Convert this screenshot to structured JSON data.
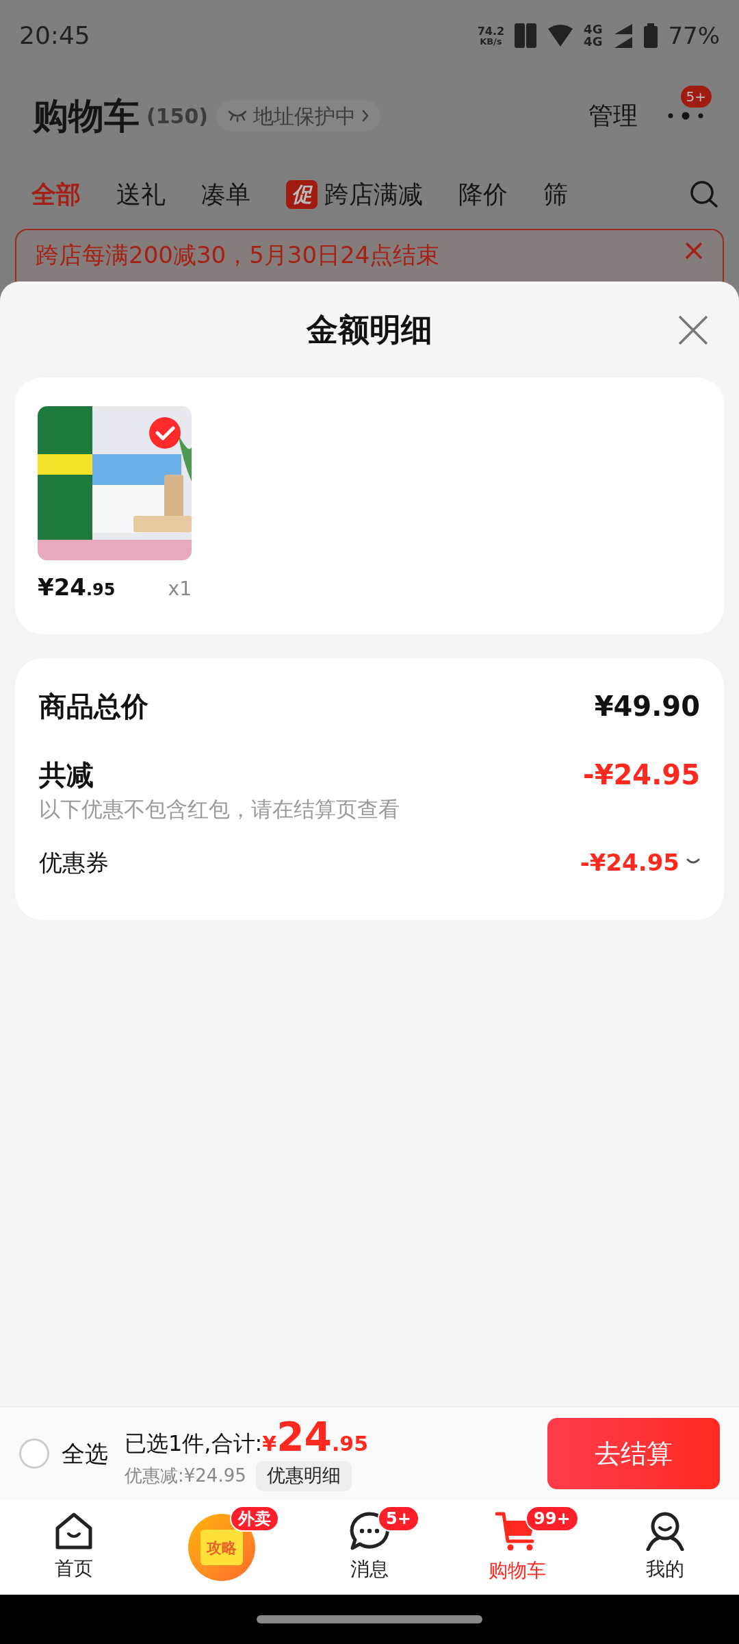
{
  "status_bar": {
    "time": "20:45",
    "net_speed": "74.2",
    "net_unit": "KB/s",
    "signal_labels": [
      "4G",
      "4G"
    ],
    "battery": "77%"
  },
  "header": {
    "title": "购物车",
    "count": "(150)",
    "address_chip": "地址保护中",
    "manage": "管理",
    "more_badge": "5+"
  },
  "filter_tabs": [
    {
      "label": "全部",
      "selected": true
    },
    {
      "label": "送礼",
      "selected": false
    },
    {
      "label": "凑单",
      "selected": false
    },
    {
      "label": "跨店满减",
      "selected": false,
      "tag": "促"
    },
    {
      "label": "降价",
      "selected": false
    },
    {
      "label": "筛",
      "selected": false
    }
  ],
  "promo_banner": {
    "text": "跨店每满200减30，5月30日24点结束"
  },
  "sheet": {
    "title": "金额明细",
    "items": [
      {
        "kind": "picture",
        "selected": true,
        "price_main": "¥24",
        "price_decimal": ".95",
        "quantity": "x1"
      }
    ],
    "summary": {
      "total_label": "商品总价",
      "total_value": "¥49.90",
      "discount_label": "共减",
      "discount_value": "-¥24.95",
      "discount_note": "以下优惠不包含红包，请在结算页查看",
      "coupon_label": "优惠券",
      "coupon_value": "-¥24.95",
      "coupon_expanded": false
    }
  },
  "checkout_bar": {
    "select_all": {
      "label": "全选",
      "checked": false
    },
    "summary_label": "已选1件,合计:",
    "currency": "¥",
    "total_main": "24",
    "total_decimal": ".95",
    "saving": "优惠减:¥24.95",
    "details_button": "优惠明细",
    "checkout_button": "去结算"
  },
  "bottom_nav": [
    {
      "kind": "home",
      "label": "首页",
      "selected": false
    },
    {
      "kind": "promo",
      "label": "攻略",
      "badge": "外卖"
    },
    {
      "kind": "message",
      "label": "消息",
      "badge": "5+",
      "selected": false
    },
    {
      "kind": "cart",
      "label": "购物车",
      "badge": "99+",
      "selected": true
    },
    {
      "kind": "profile",
      "label": "我的",
      "selected": false
    }
  ]
}
